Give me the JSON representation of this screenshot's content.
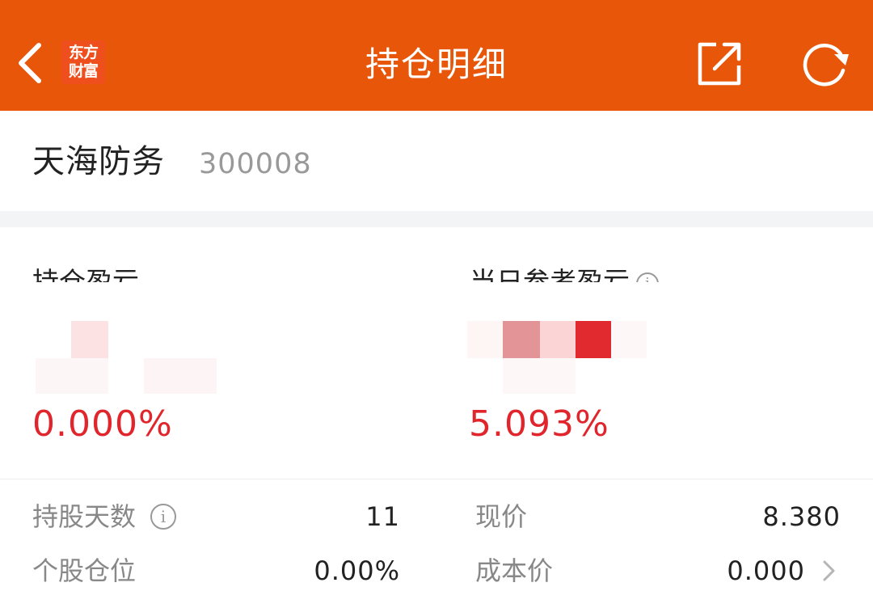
{
  "header": {
    "title": "持仓明细",
    "logo_line1": "东方",
    "logo_line2": "财富",
    "bg_color": "#E8560A",
    "icons": [
      "back-icon",
      "share-icon",
      "refresh-icon"
    ]
  },
  "stock": {
    "name": "天海防务",
    "code": "300008"
  },
  "profit": {
    "holding_label": "持仓盈亏",
    "holding_pct": "0.000%",
    "daily_label": "当日参考盈亏",
    "daily_pct": "5.093%",
    "profit_color": "#e0262c"
  },
  "details": {
    "days_label": "持股天数",
    "days_value": "11",
    "position_label": "个股仓位",
    "position_value": "0.00%",
    "price_label": "现价",
    "price_value": "8.380",
    "cost_label": "成本价",
    "cost_value": "0.000"
  }
}
